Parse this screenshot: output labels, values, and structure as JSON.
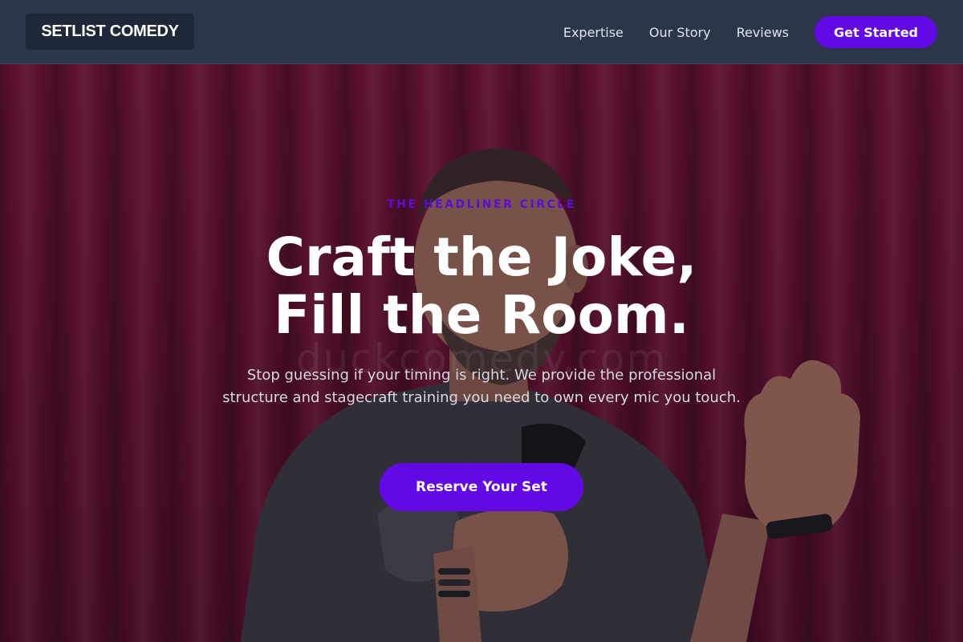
{
  "brand": {
    "name": "SETLIST COMEDY"
  },
  "nav": {
    "links": [
      "Expertise",
      "Our Story",
      "Reviews"
    ],
    "cta_label": "Get Started"
  },
  "hero": {
    "eyebrow": "THE HEADLINER CIRCLE",
    "headline_line1": "Craft the Joke,",
    "headline_line2": "Fill the Room.",
    "subtext": "Stop guessing if your timing is right. We provide the professional structure and stagecraft training you need to own every mic you touch.",
    "cta_label": "Reserve Your Set",
    "background_image": "comedian-on-stage-with-microphone",
    "watermark": "duckcomedy.com"
  },
  "colors": {
    "accent": "#6309e6",
    "navbar_bg": "#2b3648",
    "curtain": "#6a1233"
  }
}
